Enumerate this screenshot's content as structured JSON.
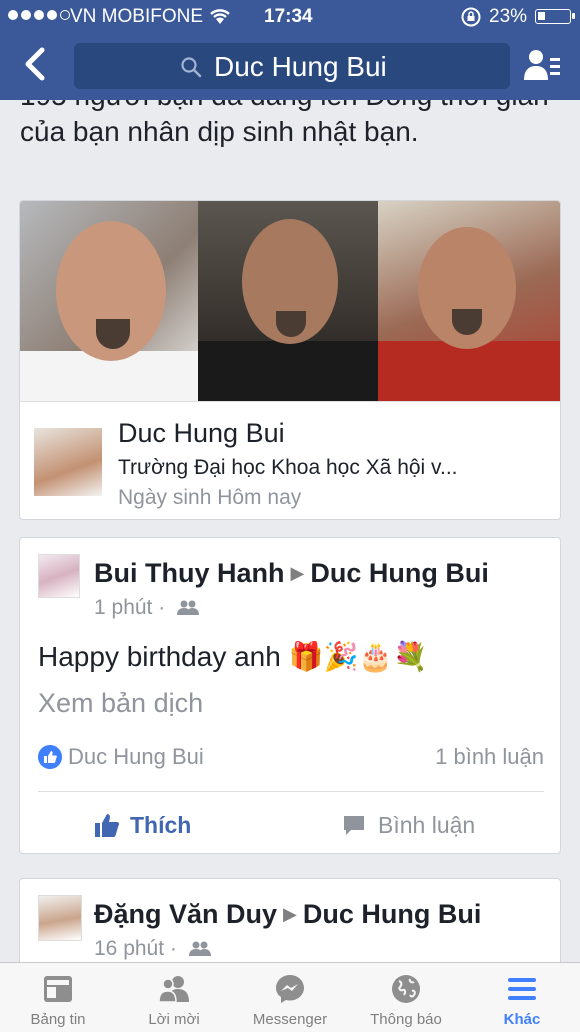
{
  "status_bar": {
    "carrier": "VN MOBIFONE",
    "time": "17:34",
    "battery": "23%"
  },
  "search": {
    "query": "Duc Hung Bui"
  },
  "intro_text": "195 người bạn đã đăng lên Dòng thời gian của bạn nhân dịp sinh nhật bạn.",
  "birthday_card": {
    "name": "Duc Hung Bui",
    "school": "Trường Đại học Khoa học Xã hội v...",
    "birthday": "Ngày sinh Hôm nay"
  },
  "post1": {
    "author": "Bui Thuy Hanh",
    "target": "Duc Hung Bui",
    "time": "1 phút",
    "text": "Happy birthday anh 🎁🎉🎂💐",
    "translate": "Xem bản dịch",
    "likers": "Duc Hung Bui",
    "comments": "1 bình luận",
    "like_label": "Thích",
    "comment_label": "Bình luận"
  },
  "post2": {
    "author": "Đặng Văn Duy",
    "target": "Duc Hung Bui",
    "time": "16 phút"
  },
  "tabs": [
    {
      "label": "Bảng tin",
      "icon": "news-feed-icon"
    },
    {
      "label": "Lời mời",
      "icon": "friend-requests-icon"
    },
    {
      "label": "Messenger",
      "icon": "messenger-icon"
    },
    {
      "label": "Thông báo",
      "icon": "notifications-globe-icon"
    },
    {
      "label": "Khác",
      "icon": "more-menu-icon",
      "active": true
    }
  ],
  "colors": {
    "brand": "#3b5998",
    "link": "#4267b2",
    "muted": "#90949c"
  }
}
